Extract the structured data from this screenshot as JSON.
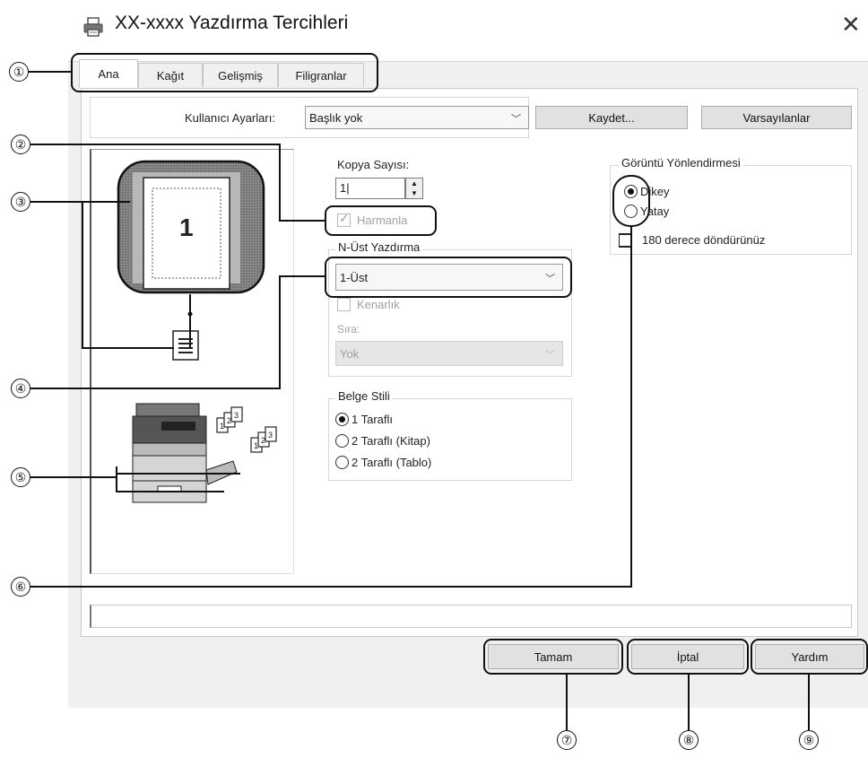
{
  "window": {
    "title": "XX-xxxx Yazdırma Tercihleri"
  },
  "tabs": [
    {
      "label": "Ana",
      "active": true
    },
    {
      "label": "Kağıt"
    },
    {
      "label": "Gelişmiş"
    },
    {
      "label": "Filigranlar"
    }
  ],
  "user_settings": {
    "label": "Kullanıcı Ayarları:",
    "value": "Başlık yok",
    "save_label": "Kaydet...",
    "defaults_label": "Varsayılanlar"
  },
  "preview": {
    "page_number": "1"
  },
  "copies": {
    "label": "Kopya Sayısı:",
    "value": "1",
    "collate_label": "Harmanla"
  },
  "nup": {
    "group_label": "N-Üst Yazdırma",
    "value": "1-Üst",
    "border_label": "Kenarlık",
    "order_label": "Sıra:",
    "order_value": "Yok"
  },
  "orientation": {
    "group_label": "Görüntü Yönlendirmesi",
    "options": [
      "Dikey",
      "Yatay"
    ],
    "selected": "Dikey",
    "rotate_label": "180 derece döndürünüz"
  },
  "document_style": {
    "group_label": "Belge Stili",
    "options": [
      "1 Taraflı",
      "2 Taraflı (Kitap)",
      "2 Taraflı (Tablo)"
    ],
    "selected": "1 Taraflı"
  },
  "footer": {
    "ok_label": "Tamam",
    "cancel_label": "İptal",
    "help_label": "Yardım"
  },
  "callouts": [
    "①",
    "②",
    "③",
    "④",
    "⑤",
    "⑥",
    "⑦",
    "⑧",
    "⑨"
  ]
}
